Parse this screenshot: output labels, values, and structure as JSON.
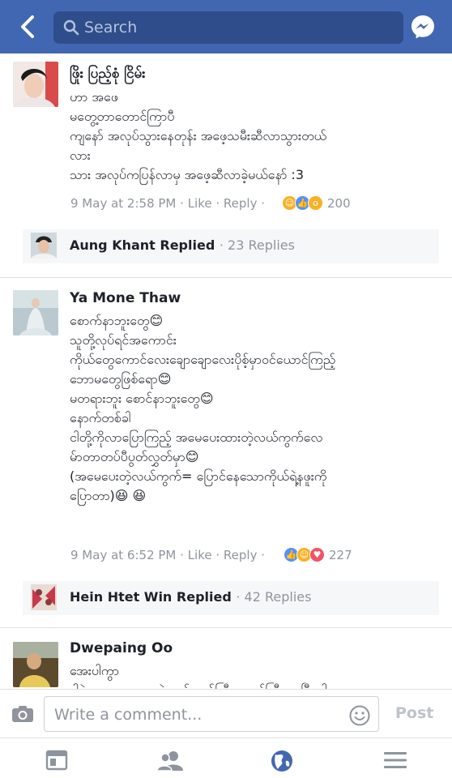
{
  "header": {
    "search_placeholder": "Search",
    "brand_color": "#4267b2"
  },
  "comments": [
    {
      "author": "ဖြိုး ပြည့်စုံ ငြိမ်း",
      "lines": [
        "ဟာ အဖေ",
        "မတွေ့တာတောင်ကြာပီ",
        "ကျနော် အလုပ်သွားနေတုန်း အဖေ့သမီးဆီလာသွားတယ်",
        "လား",
        "သား အလုပ်ကပြန်လာမှ အဖေ့ဆီလာခဲ့မယ်နော် :3"
      ],
      "time": "9 May at 2:58 PM",
      "like_label": "Like",
      "reply_label": "Reply",
      "reaction_count": "200",
      "reply": {
        "name": "Aung Khant Replied",
        "count": "23 Replies"
      }
    },
    {
      "author": "Ya Mone Thaw",
      "lines": [
        "စောက်နာဘူးတွေ😊",
        "သူတို့လုပ်ရင်အကောင်း",
        "ကိုယ်တွေကောင်လေးချောချောလေးပိုစ့်မှာဝင်ယောင်ကြည့်",
        "ဘောမတွေဖြစ်ရော😊",
        "မတရားဘူး စောင်နာဘူးတွေ😊",
        "နောက်တစ်ခါ",
        "ငါတို့ကိုလာပြောကြည့် အမေပေးထားတဲ့လယ်ကွက်လေ",
        "မ်ာတာတပ်ပီပွတ်လွှတ်မှာ😊",
        "(အမေပေးတဲ့လယ်ကွက်= ပြောင်နေသောကိုယ်ရဲ့နဖူးကို",
        "ပြောတာ)😆 😆"
      ],
      "time": "9 May at 6:52 PM",
      "like_label": "Like",
      "reply_label": "Reply",
      "reaction_count": "227",
      "reply": {
        "name": "Hein Htet Win Replied",
        "count": "42 Replies"
      }
    },
    {
      "author": "Dwepaing Oo",
      "lines": [
        "အေးပါကွာ",
        "ဒါနဲ့ကလေးတွေကလဲတော်တော်ကြီးတောင်ကြီးလာပြီပေါ့ ။ ။"
      ]
    }
  ],
  "composer": {
    "placeholder": "Write a comment...",
    "post_label": "Post"
  }
}
